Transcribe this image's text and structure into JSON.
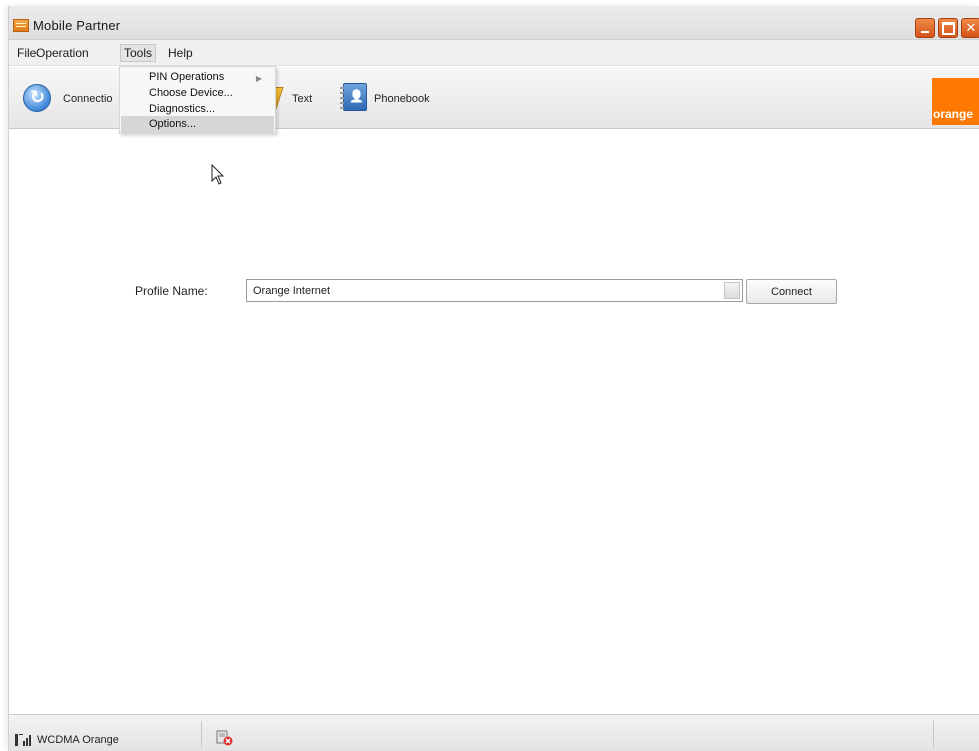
{
  "window": {
    "title": "Mobile Partner"
  },
  "menu": {
    "file": "File",
    "operation": "Operation",
    "tools": "Tools",
    "help": "Help"
  },
  "toolbar": {
    "connection_label": "Connectio",
    "text_label": "Text",
    "phonebook_label": "Phonebook",
    "brand_logo": "orange",
    "brand_color": "#ff7900"
  },
  "tools_menu": {
    "items": [
      {
        "label": "PIN Operations",
        "has_submenu": true
      },
      {
        "label": "Choose Device..."
      },
      {
        "label": "Diagnostics..."
      },
      {
        "label": "Options...",
        "highlighted": true
      }
    ]
  },
  "profile": {
    "label": "Profile Name:",
    "value": "Orange Internet",
    "connect_button": "Connect"
  },
  "status": {
    "network": "WCDMA Orange"
  },
  "icons": {
    "connection": "connection-icon",
    "text": "text-message-icon",
    "phonebook": "phonebook-icon",
    "signal": "signal-strength-icon",
    "device": "device-disconnected-icon"
  }
}
